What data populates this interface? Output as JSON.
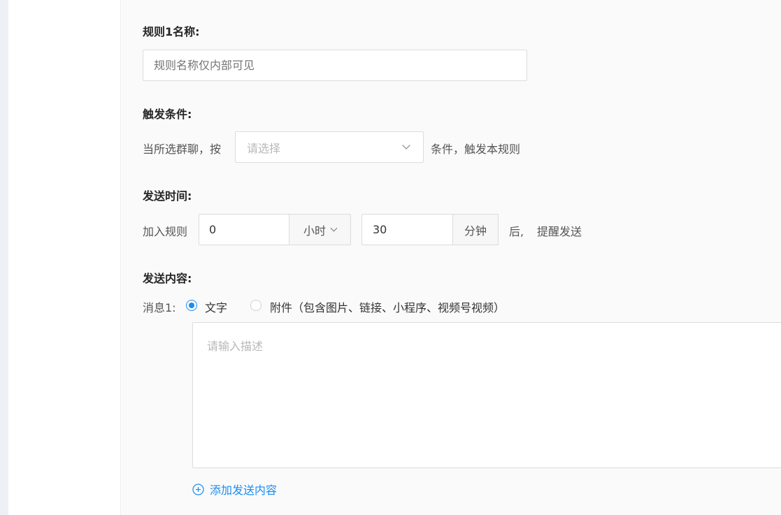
{
  "rule": {
    "name_label": "规则1名称:",
    "name_placeholder": "规则名称仅内部可见"
  },
  "trigger": {
    "label": "触发条件:",
    "prefix": "当所选群聊，按",
    "select_placeholder": "请选择",
    "suffix": "条件，触发本规则"
  },
  "send_time": {
    "label": "发送时间:",
    "prefix": "加入规则",
    "hours_value": "0",
    "hours_unit": "小时",
    "minutes_value": "30",
    "minutes_unit": "分钟",
    "suffix_1": "后,",
    "suffix_2": "提醒发送"
  },
  "content": {
    "label": "发送内容:",
    "message_label": "消息1:",
    "option_text": "文字",
    "option_attachment": "附件（包含图片、链接、小程序、视频号视频）",
    "selected_option": "文字",
    "textarea_placeholder": "请输入描述",
    "add_label": "添加发送内容"
  },
  "colors": {
    "accent": "#1a8cf2",
    "content_bg": "#fafafa",
    "border": "#dcdcdc"
  }
}
